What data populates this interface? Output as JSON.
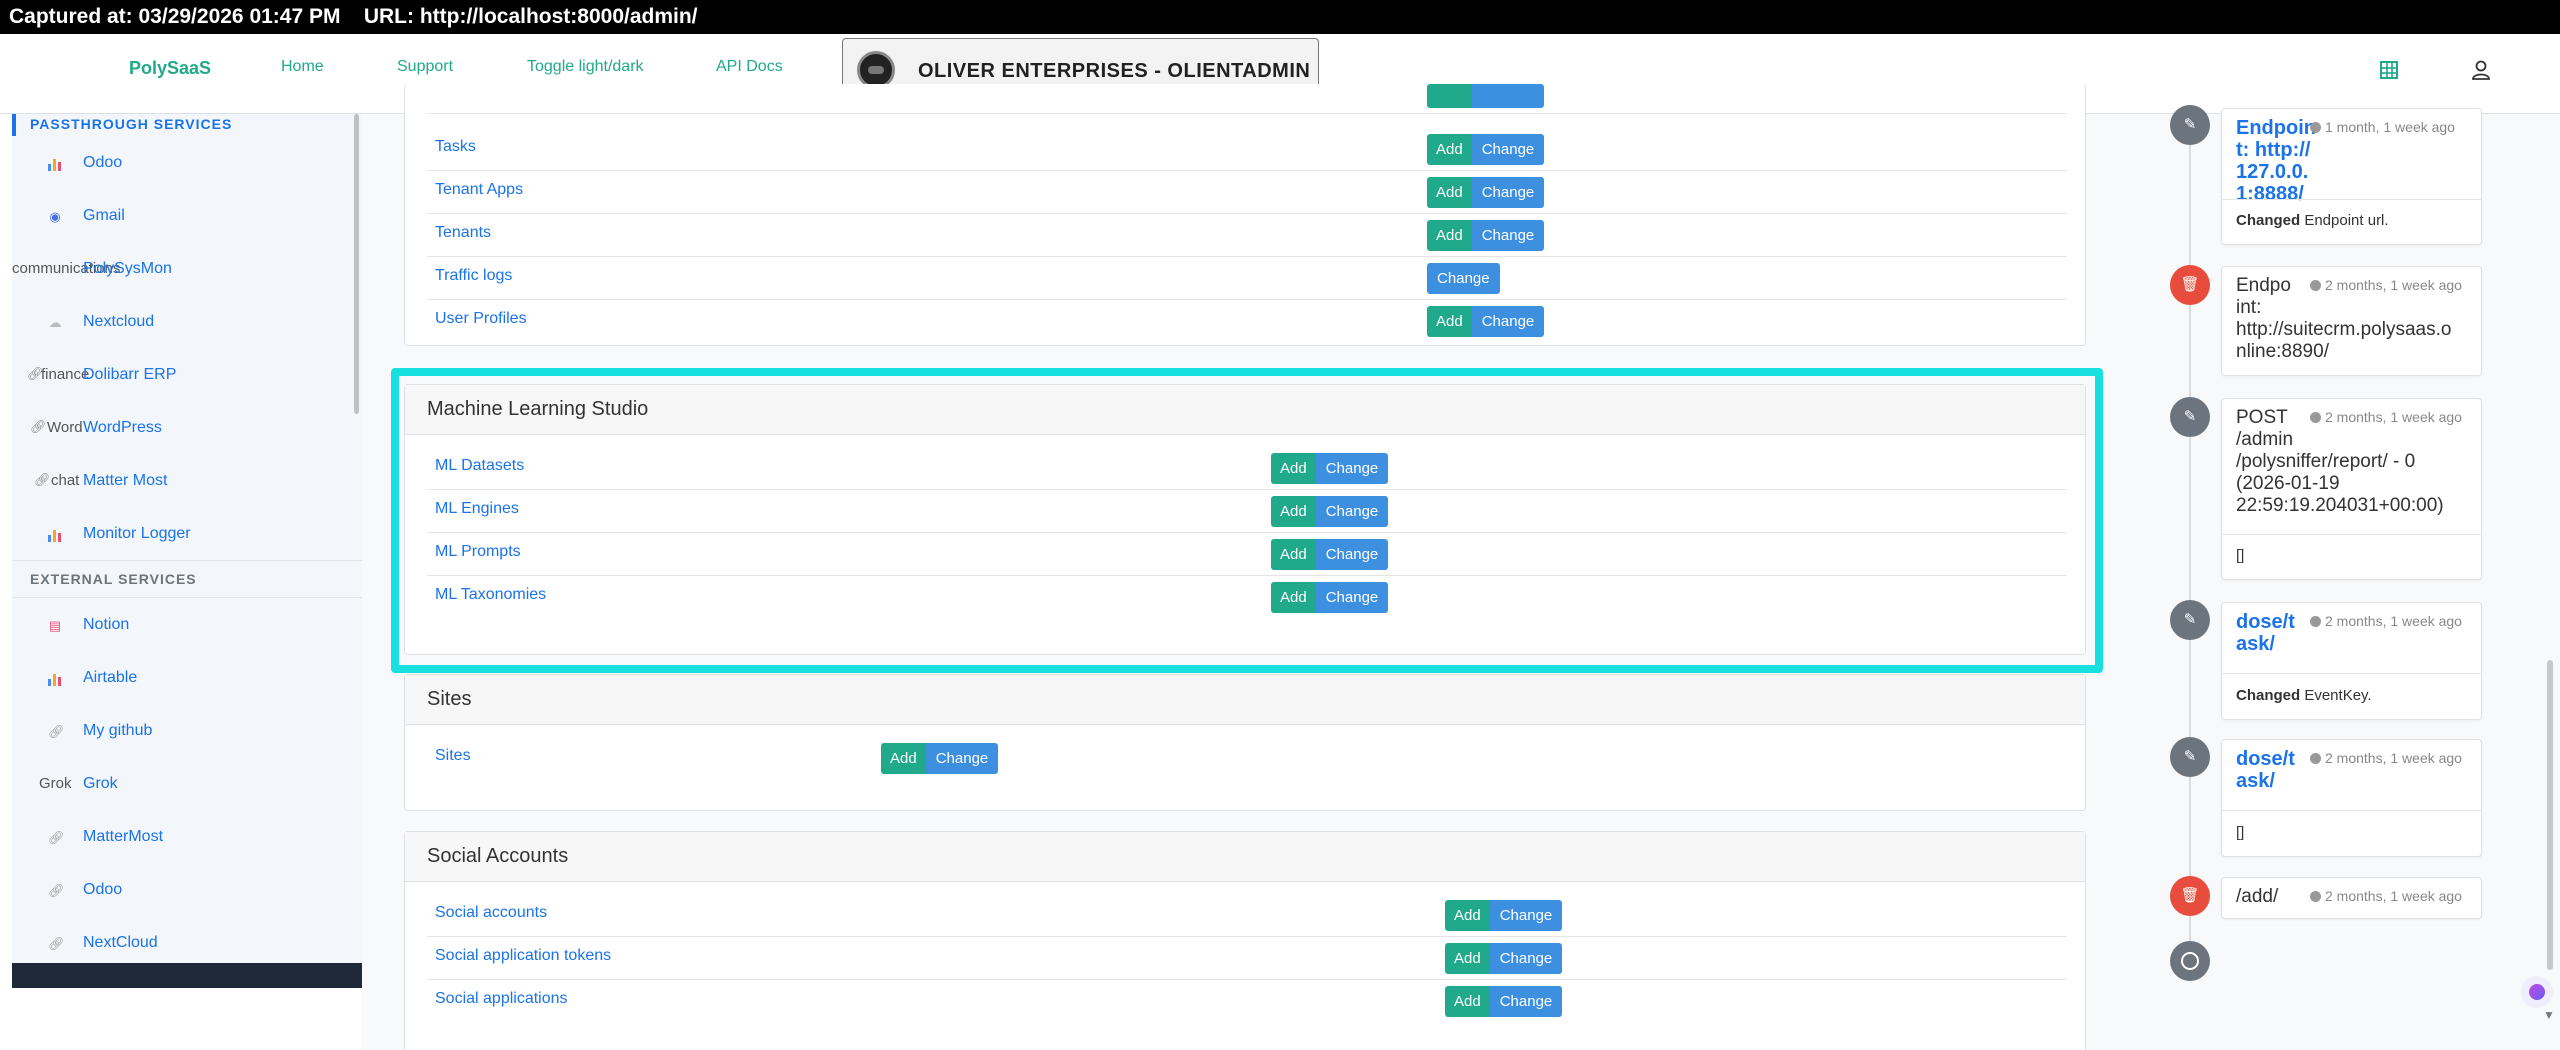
{
  "capture": {
    "text": "Captured at: 03/29/2026 01:47 PM    URL: http://localhost:8000/admin/"
  },
  "nav": {
    "brand": "PolySaaS",
    "links": [
      "Home",
      "Support",
      "Toggle light/dark",
      "API Docs"
    ],
    "tenant": "OLIVER ENTERPRISES - OLIENTADMIN"
  },
  "sidebar": {
    "section1": "PASSTHROUGH SERVICES",
    "items": [
      {
        "label": "Odoo",
        "icon": "chart-bars-icon"
      },
      {
        "label": "Gmail",
        "icon": "circle-dot-icon"
      },
      {
        "prefix": "communications",
        "label": "PolySysMon"
      },
      {
        "label": "Nextcloud",
        "icon": "cloud-icon"
      },
      {
        "prefix": "finance",
        "label": "Dolibarr ERP",
        "icon": "link-icon"
      },
      {
        "prefix": "Word",
        "label": "WordPress",
        "icon": "link-icon"
      },
      {
        "prefix": "chat",
        "label": "Matter Most",
        "icon": "link-icon"
      },
      {
        "label": "Monitor Logger",
        "icon": "chart-bars-icon"
      }
    ],
    "section2": "EXTERNAL SERVICES",
    "items2": [
      {
        "label": "Notion",
        "icon": "notebook-icon"
      },
      {
        "label": "Airtable",
        "icon": "chart-bars-icon"
      },
      {
        "label": "My github",
        "icon": "link-icon"
      },
      {
        "prefix": "Grok",
        "label": "Grok"
      },
      {
        "label": "MatterMost",
        "icon": "link-icon"
      },
      {
        "label": "Odoo",
        "icon": "link-icon"
      },
      {
        "label": "NextCloud",
        "icon": "link-icon"
      }
    ]
  },
  "modules": {
    "top_rows": [
      {
        "name": "Tasks",
        "add": "Add",
        "change": "Change"
      },
      {
        "name": "Tenant Apps",
        "add": "Add",
        "change": "Change"
      },
      {
        "name": "Tenants",
        "add": "Add",
        "change": "Change"
      },
      {
        "name": "Traffic logs",
        "change": "Change"
      },
      {
        "name": "User Profiles",
        "add": "Add",
        "change": "Change"
      }
    ],
    "ml": {
      "title": "Machine Learning Studio",
      "rows": [
        {
          "name": "ML Datasets",
          "add": "Add",
          "change": "Change"
        },
        {
          "name": "ML Engines",
          "add": "Add",
          "change": "Change"
        },
        {
          "name": "ML Prompts",
          "add": "Add",
          "change": "Change"
        },
        {
          "name": "ML Taxonomies",
          "add": "Add",
          "change": "Change"
        }
      ]
    },
    "sites": {
      "title": "Sites",
      "rows": [
        {
          "name": "Sites",
          "add": "Add",
          "change": "Change"
        }
      ]
    },
    "social": {
      "title": "Social Accounts",
      "rows": [
        {
          "name": "Social accounts",
          "add": "Add",
          "change": "Change"
        },
        {
          "name": "Social application tokens",
          "add": "Add",
          "change": "Change"
        },
        {
          "name": "Social applications",
          "add": "Add",
          "change": "Change"
        }
      ]
    }
  },
  "timeline": [
    {
      "type": "edit",
      "title": "Endpoint: http://127.0.0.1:8888/",
      "time": "1 month, 1 week ago",
      "body_bold": "Changed",
      "body": " Endpoint url."
    },
    {
      "type": "delete",
      "title": "Endpoint: http://suitecrm.polysaas.online:8890/",
      "time": "2 months, 1 week ago"
    },
    {
      "type": "edit",
      "title": "POST /admin /polysniffer/report/ - 0 (2026-01-19 22:59:19.204031+00:00)",
      "time": "2 months, 1 week ago",
      "body": "[]"
    },
    {
      "type": "edit",
      "title": "dose/task/",
      "time": "2 months, 1 week ago",
      "body_bold": "Changed",
      "body": " EventKey."
    },
    {
      "type": "edit",
      "title": "dose/task/",
      "time": "2 months, 1 week ago",
      "body": "[]"
    },
    {
      "type": "delete",
      "title": "/add/",
      "time": "2 months, 1 week ago"
    }
  ],
  "colors": {
    "accent": "#20a98a",
    "link": "#1a73e8",
    "change_button": "#3d8fe0",
    "highlight": "#19e0e0",
    "delete": "#e74c3c"
  }
}
